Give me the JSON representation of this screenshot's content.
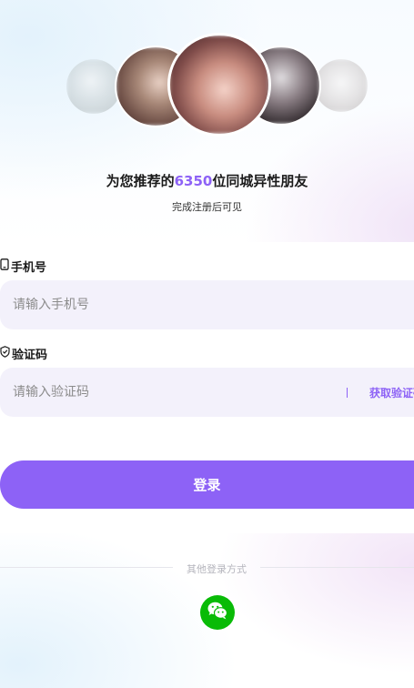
{
  "headline": {
    "prefix": "为您推荐的",
    "count": "6350",
    "suffix": "位同城异性朋友"
  },
  "subline": "完成注册后可见",
  "avatars": [
    "avatar-1",
    "avatar-2",
    "avatar-3",
    "avatar-4",
    "avatar-5"
  ],
  "form": {
    "phone": {
      "label": "手机号",
      "icon": "phone-icon",
      "placeholder": "请输入手机号",
      "value": ""
    },
    "code": {
      "label": "验证码",
      "icon": "shield-check-icon",
      "placeholder": "请输入验证码",
      "value": "",
      "get_code_label": "获取验证码"
    },
    "login_label": "登录"
  },
  "other_login": {
    "label": "其他登录方式",
    "methods": [
      {
        "name": "wechat",
        "icon": "wechat-icon"
      }
    ]
  },
  "colors": {
    "accent": "#8d62f6",
    "input_bg": "#f3f1fb",
    "wechat": "#09bb07"
  }
}
